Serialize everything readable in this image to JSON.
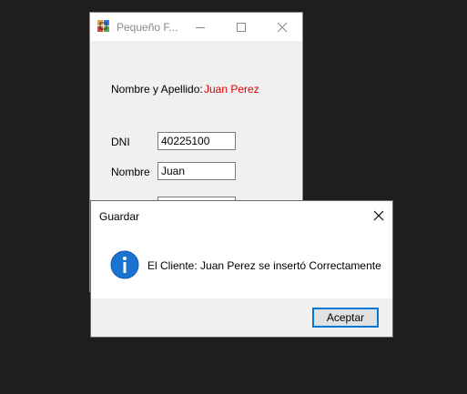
{
  "form_window": {
    "title": "Pequeño F...",
    "name_label": "Nombre y Apellido:",
    "name_value": "Juan Perez",
    "dni_label": "DNI",
    "dni_value": "40225100",
    "nombre_label": "Nombre",
    "nombre_value": "Juan",
    "title_color": "#8a8a8a",
    "value_color": "#e00000"
  },
  "dialog": {
    "title": "Guardar",
    "message": "El Cliente: Juan Perez se insertó Correctamente",
    "accept_label": "Aceptar",
    "icon": "info-icon",
    "accent_color": "#0078d7"
  }
}
